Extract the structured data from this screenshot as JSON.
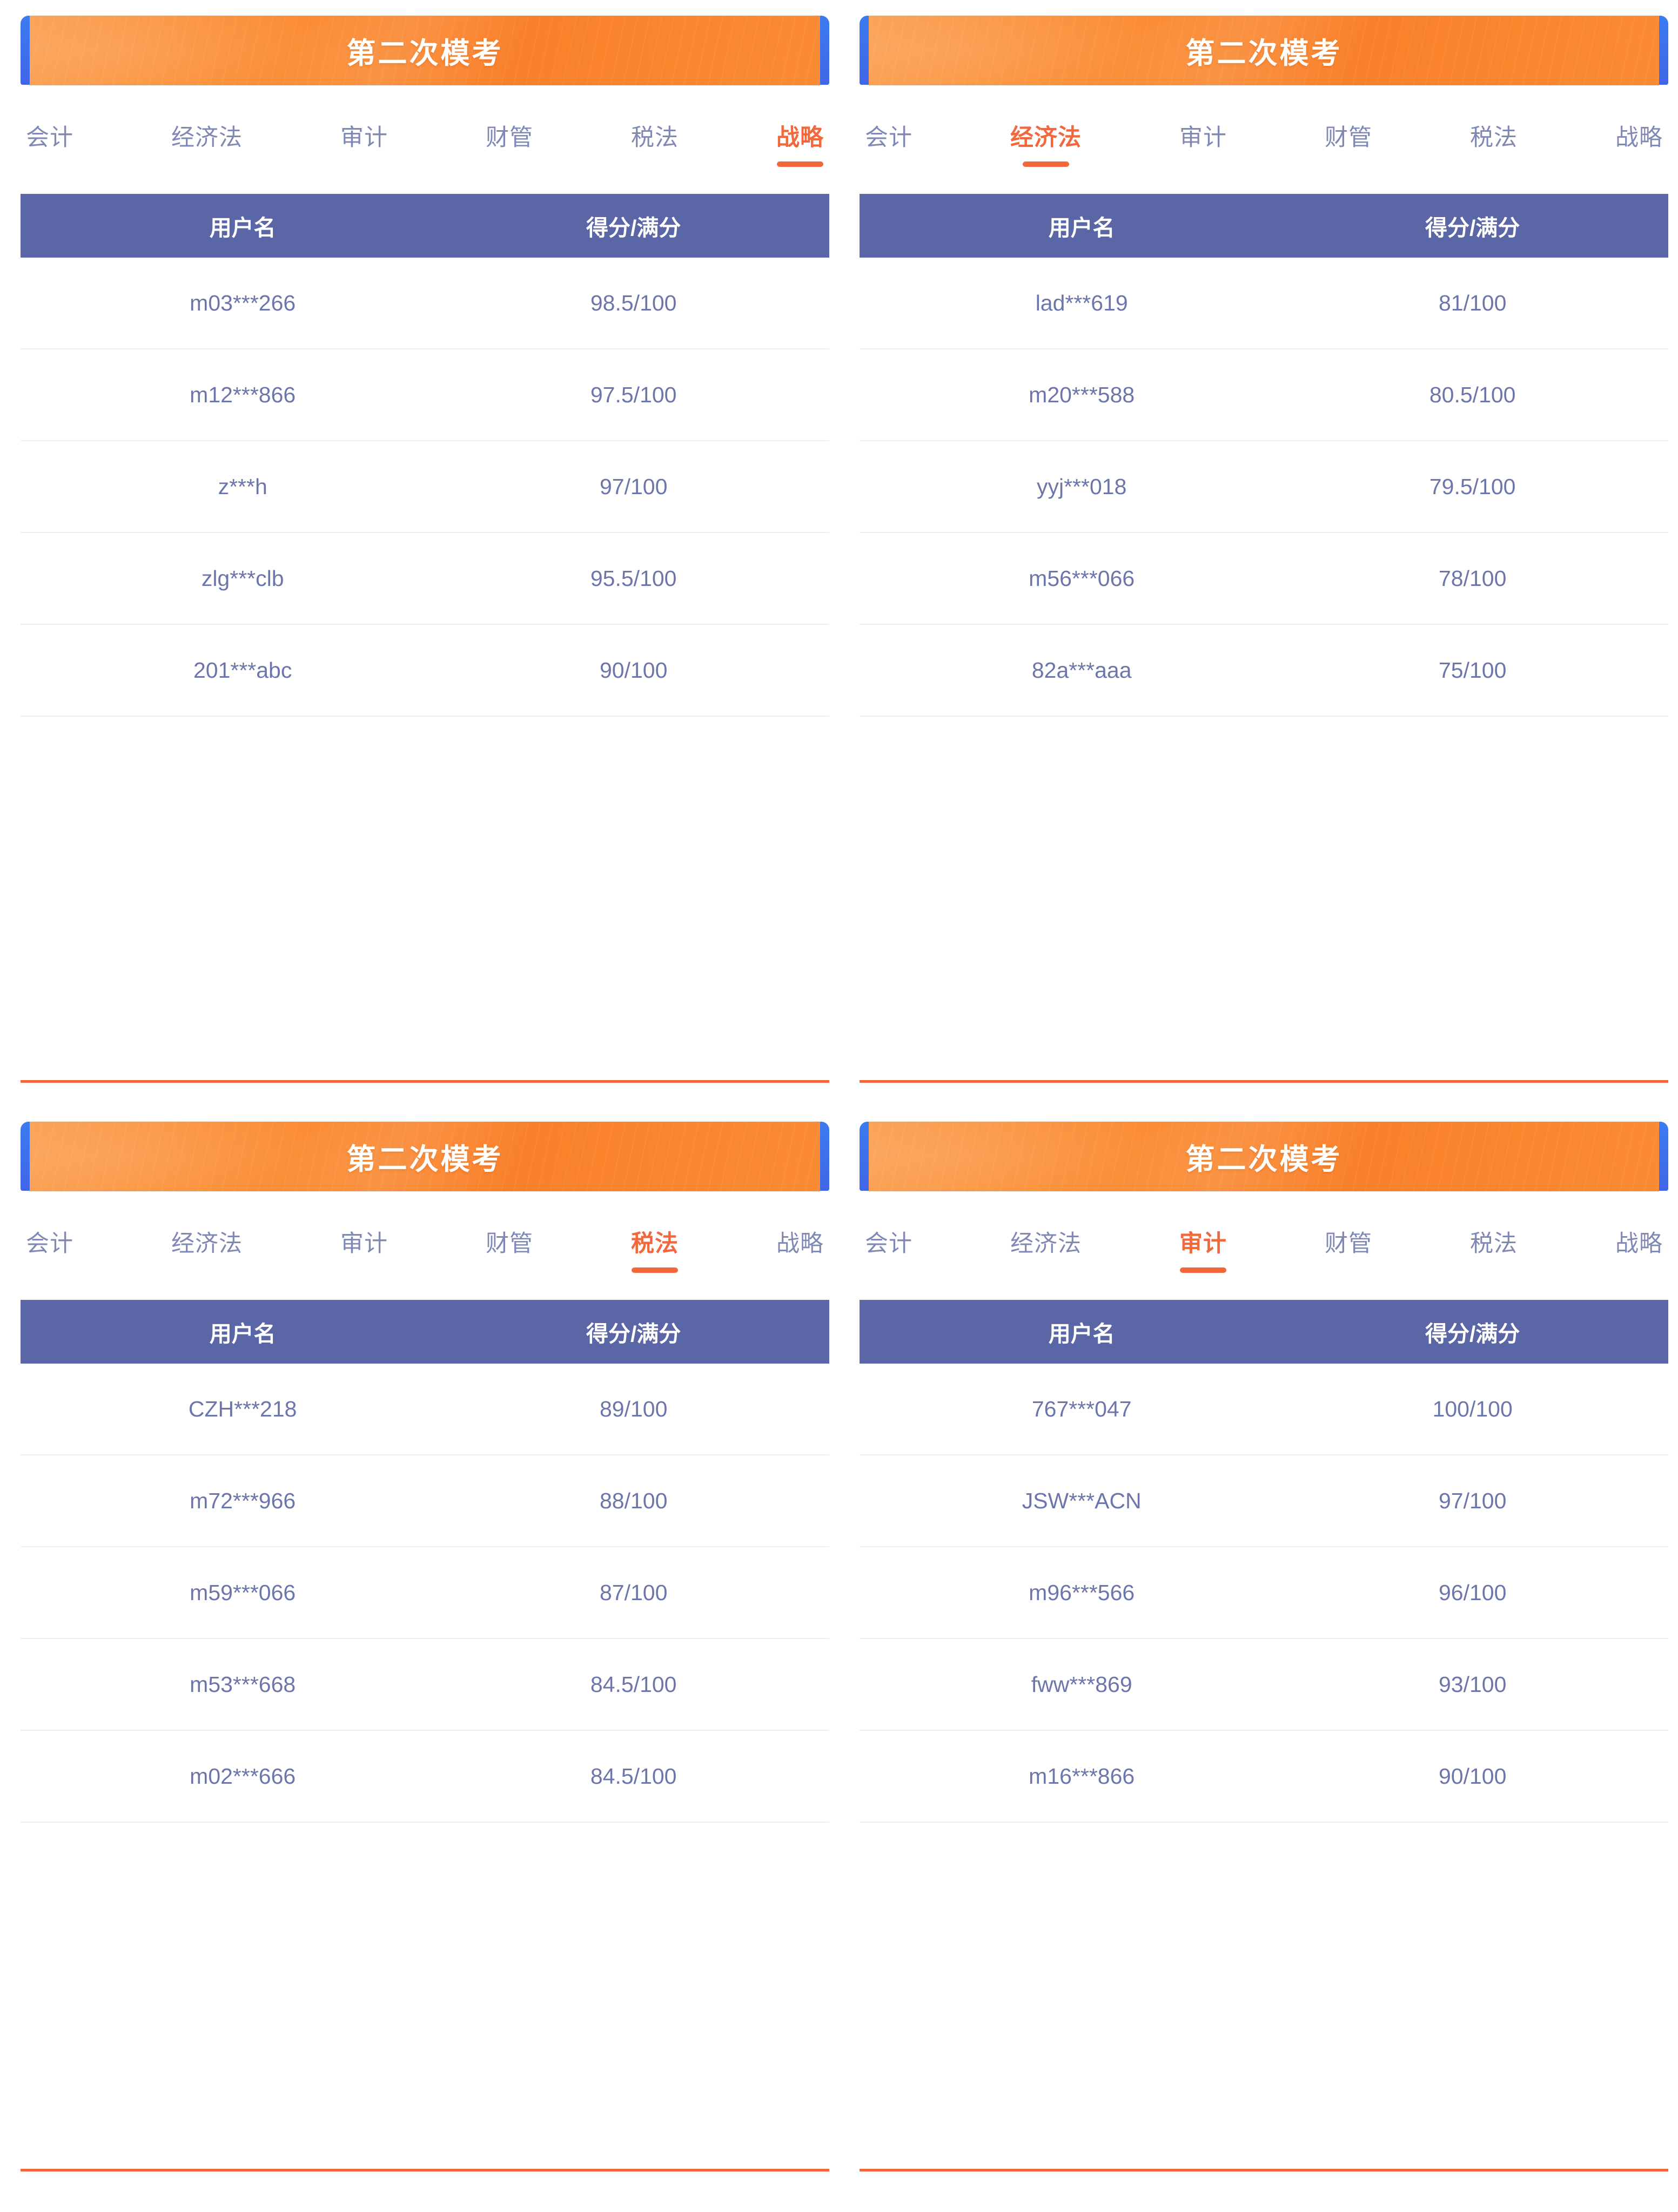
{
  "banner": {
    "title": "第二次模考"
  },
  "colors": {
    "banner_orange": "#fb8a31",
    "banner_blue_tab": "#3c7bf0",
    "accent_orange": "#f2683c",
    "table_header_purple": "#5a66a6",
    "tab_inactive": "#8089b4",
    "row_text": "#6c76ab",
    "row_divider": "#eceef4"
  },
  "table_headers": {
    "username": "用户名",
    "score": "得分/满分"
  },
  "panels": [
    {
      "id": "panel-strategy",
      "banner_title": "第二次模考",
      "active_tab": "战略",
      "tabs": [
        {
          "label": "会计",
          "active": false
        },
        {
          "label": "经济法",
          "active": false
        },
        {
          "label": "审计",
          "active": false
        },
        {
          "label": "财管",
          "active": false
        },
        {
          "label": "税法",
          "active": false
        },
        {
          "label": "战略",
          "active": true
        }
      ],
      "rows": [
        {
          "username": "m03***266",
          "score": "98.5/100"
        },
        {
          "username": "m12***866",
          "score": "97.5/100"
        },
        {
          "username": "z***h",
          "score": "97/100"
        },
        {
          "username": "zlg***clb",
          "score": "95.5/100"
        },
        {
          "username": "201***abc",
          "score": "90/100"
        }
      ]
    },
    {
      "id": "panel-economic-law",
      "banner_title": "第二次模考",
      "active_tab": "经济法",
      "tabs": [
        {
          "label": "会计",
          "active": false
        },
        {
          "label": "经济法",
          "active": true
        },
        {
          "label": "审计",
          "active": false
        },
        {
          "label": "财管",
          "active": false
        },
        {
          "label": "税法",
          "active": false
        },
        {
          "label": "战略",
          "active": false
        }
      ],
      "rows": [
        {
          "username": "lad***619",
          "score": "81/100"
        },
        {
          "username": "m20***588",
          "score": "80.5/100"
        },
        {
          "username": "yyj***018",
          "score": "79.5/100"
        },
        {
          "username": "m56***066",
          "score": "78/100"
        },
        {
          "username": "82a***aaa",
          "score": "75/100"
        }
      ]
    },
    {
      "id": "panel-tax-law",
      "banner_title": "第二次模考",
      "active_tab": "税法",
      "tabs": [
        {
          "label": "会计",
          "active": false
        },
        {
          "label": "经济法",
          "active": false
        },
        {
          "label": "审计",
          "active": false
        },
        {
          "label": "财管",
          "active": false
        },
        {
          "label": "税法",
          "active": true
        },
        {
          "label": "战略",
          "active": false
        }
      ],
      "rows": [
        {
          "username": "CZH***218",
          "score": "89/100"
        },
        {
          "username": "m72***966",
          "score": "88/100"
        },
        {
          "username": "m59***066",
          "score": "87/100"
        },
        {
          "username": "m53***668",
          "score": "84.5/100"
        },
        {
          "username": "m02***666",
          "score": "84.5/100"
        }
      ]
    },
    {
      "id": "panel-audit",
      "banner_title": "第二次模考",
      "active_tab": "审计",
      "tabs": [
        {
          "label": "会计",
          "active": false
        },
        {
          "label": "经济法",
          "active": false
        },
        {
          "label": "审计",
          "active": true
        },
        {
          "label": "财管",
          "active": false
        },
        {
          "label": "税法",
          "active": false
        },
        {
          "label": "战略",
          "active": false
        }
      ],
      "rows": [
        {
          "username": "767***047",
          "score": "100/100"
        },
        {
          "username": "JSW***ACN",
          "score": "97/100"
        },
        {
          "username": "m96***566",
          "score": "96/100"
        },
        {
          "username": "fww***869",
          "score": "93/100"
        },
        {
          "username": "m16***866",
          "score": "90/100"
        }
      ]
    }
  ]
}
